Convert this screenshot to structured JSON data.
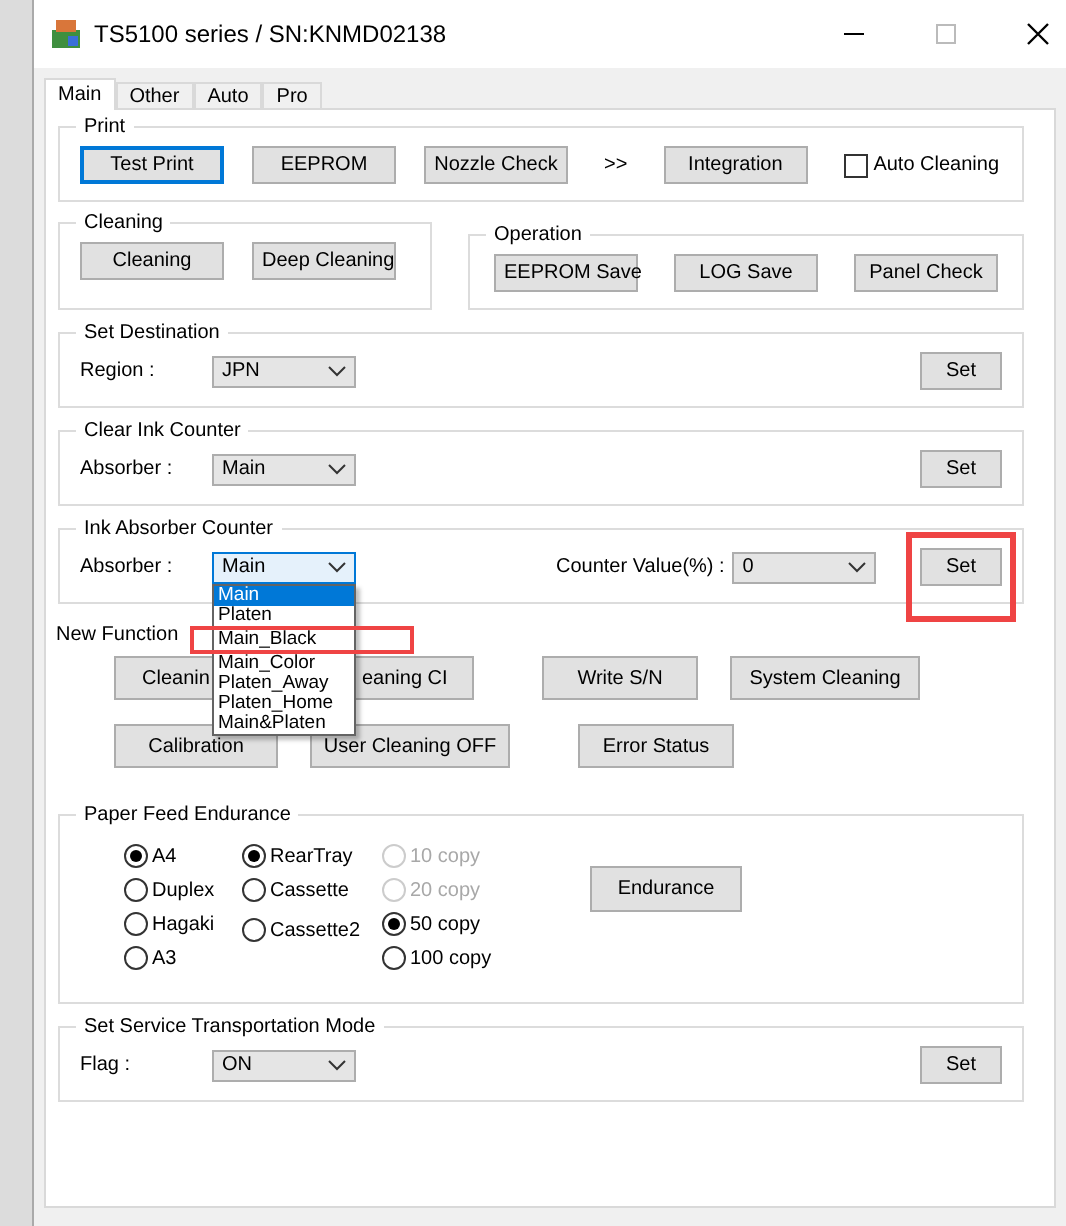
{
  "window": {
    "title": "TS5100 series / SN:KNMD02138"
  },
  "tabs": [
    {
      "label": "Main",
      "selected": true
    },
    {
      "label": "Other",
      "selected": false
    },
    {
      "label": "Auto",
      "selected": false
    },
    {
      "label": "Pro",
      "selected": false
    }
  ],
  "print": {
    "title": "Print",
    "buttons": [
      {
        "label": "Test Print",
        "focused": true
      },
      {
        "label": "EEPROM",
        "focused": false
      },
      {
        "label": "Nozzle Check",
        "focused": false
      }
    ],
    "separator": ">>",
    "next_button": "Integration",
    "auto_cleaning": {
      "label": "Auto Cleaning",
      "checked": false
    }
  },
  "cleaning": {
    "title": "Cleaning",
    "buttons": [
      "Cleaning",
      "Deep Cleaning"
    ]
  },
  "operation": {
    "title": "Operation",
    "buttons": [
      "EEPROM Save",
      "LOG Save",
      "Panel Check"
    ]
  },
  "set_destination": {
    "title": "Set Destination",
    "field_label": "Region :",
    "value": "JPN",
    "button": "Set"
  },
  "clear_ink_counter": {
    "title": "Clear Ink Counter",
    "field_label": "Absorber :",
    "value": "Main",
    "button": "Set"
  },
  "ink_absorber_counter": {
    "title": "Ink Absorber Counter",
    "field_label": "Absorber :",
    "value": "Main",
    "counter_label": "Counter Value(%) :",
    "counter_value": "0",
    "button": "Set",
    "button_highlighted": true,
    "dropdown": [
      {
        "label": "Main",
        "selected": true,
        "highlighted": false
      },
      {
        "label": "Platen",
        "selected": false,
        "highlighted": false
      },
      {
        "label": "Main_Black",
        "selected": false,
        "highlighted": true
      },
      {
        "label": "Main_Color",
        "selected": false,
        "highlighted": false
      },
      {
        "label": "Platen_Away",
        "selected": false,
        "highlighted": false
      },
      {
        "label": "Platen_Home",
        "selected": false,
        "highlighted": false
      },
      {
        "label": "Main&Platen",
        "selected": false,
        "highlighted": false
      }
    ]
  },
  "new_function": {
    "title": "New Function",
    "rows": [
      [
        "Cleanin",
        "eaning CI",
        "Write S/N",
        "System Cleaning"
      ],
      [
        "Calibration",
        "User Cleaning OFF",
        "Error Status"
      ]
    ]
  },
  "paper_feed_endurance": {
    "title": "Paper Feed Endurance",
    "columns": [
      [
        {
          "label": "A4",
          "selected": true,
          "disabled": false
        },
        {
          "label": "Duplex",
          "selected": false,
          "disabled": false
        },
        {
          "label": "Hagaki",
          "selected": false,
          "disabled": false
        },
        {
          "label": "A3",
          "selected": false,
          "disabled": false
        }
      ],
      [
        {
          "label": "RearTray",
          "selected": true,
          "disabled": false
        },
        {
          "label": "Cassette",
          "selected": false,
          "disabled": false
        },
        {
          "label": "Cassette2",
          "selected": false,
          "disabled": false
        }
      ],
      [
        {
          "label": "10 copy",
          "selected": false,
          "disabled": true
        },
        {
          "label": "20 copy",
          "selected": false,
          "disabled": true
        },
        {
          "label": "50 copy",
          "selected": true,
          "disabled": false
        },
        {
          "label": "100 copy",
          "selected": false,
          "disabled": false
        }
      ]
    ],
    "button": "Endurance"
  },
  "service_transportation": {
    "title": "Set Service Transportation Mode",
    "field_label": "Flag :",
    "value": "ON",
    "button": "Set"
  }
}
